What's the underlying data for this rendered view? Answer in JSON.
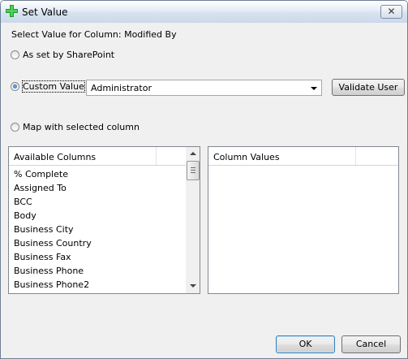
{
  "window": {
    "title": "Set Value",
    "close_glyph": "✕",
    "icon": "green-plus-icon",
    "colors": {
      "title_icon": "#1f9e2a",
      "radio_selected": "#1d5fb0"
    }
  },
  "prompt": "Select Value for Column: Modified By",
  "options": {
    "sharepoint": "As set by SharePoint",
    "custom": "Custom Value",
    "map": "Map with selected column"
  },
  "custom_value": {
    "selected": "Administrator"
  },
  "buttons": {
    "validate": "Validate User",
    "ok": "OK",
    "cancel": "Cancel"
  },
  "available_columns": {
    "header": "Available Columns",
    "items": [
      "% Complete",
      "Assigned To",
      "BCC",
      "Body",
      "Business City",
      "Business Country",
      "Business Fax",
      "Business Phone",
      "Business Phone2"
    ]
  },
  "column_values": {
    "header": "Column Values",
    "items": []
  }
}
